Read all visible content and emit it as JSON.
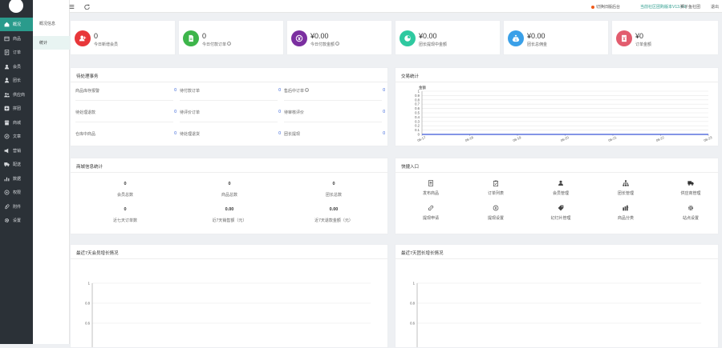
{
  "sidebar": {
    "items": [
      {
        "label": "概况",
        "icon": "home-icon",
        "active": true
      },
      {
        "label": "商品",
        "icon": "box-icon"
      },
      {
        "label": "订单",
        "icon": "order-icon"
      },
      {
        "label": "会员",
        "icon": "user-icon"
      },
      {
        "label": "团长",
        "icon": "leader-icon"
      },
      {
        "label": "供应商",
        "icon": "supplier-icon"
      },
      {
        "label": "拼团",
        "icon": "group-icon"
      },
      {
        "label": "商城",
        "icon": "shop-icon"
      },
      {
        "label": "文章",
        "icon": "article-icon"
      },
      {
        "label": "营销",
        "icon": "marketing-icon"
      },
      {
        "label": "配送",
        "icon": "truck-icon"
      },
      {
        "label": "数据",
        "icon": "data-icon"
      },
      {
        "label": "权限",
        "icon": "lock-icon"
      },
      {
        "label": "附件",
        "icon": "attachment-icon"
      },
      {
        "label": "设置",
        "icon": "gear-icon"
      }
    ]
  },
  "subnav": {
    "title": "概况信息",
    "items": [
      {
        "label": "统计",
        "active": true
      }
    ]
  },
  "topbar": {
    "switch_label": "切换旧版后台",
    "version_label": "当前社区团购版本V13.4.0",
    "store_label": "狮子鱼社团",
    "logout_label": "退出"
  },
  "stats": [
    {
      "value": "0",
      "label": "今日新增会员",
      "color": "#e8373a",
      "icon": "user-add-icon",
      "help": false
    },
    {
      "value": "0",
      "label": "今日付款订单",
      "color": "#3db54a",
      "icon": "document-icon",
      "help": true
    },
    {
      "value": "¥0.00",
      "label": "今日付款金额",
      "color": "#7b2fa0",
      "icon": "yen-icon",
      "help": true
    },
    {
      "value": "¥0.00",
      "label": "团长提现中金额",
      "color": "#2fc9a0",
      "icon": "pie-icon",
      "help": false
    },
    {
      "value": "¥0.00",
      "label": "团长总佣金",
      "color": "#3aa0e8",
      "icon": "money-bag-icon",
      "help": false
    },
    {
      "value": "¥0",
      "label": "订单金额",
      "color": "#e25c6e",
      "icon": "receipt-icon",
      "help": false
    }
  ],
  "todo": {
    "title": "待处理事务",
    "items": [
      {
        "label": "商品库存报警",
        "value": "0",
        "help": false
      },
      {
        "label": "待付款订单",
        "value": "0",
        "help": false
      },
      {
        "label": "售后中订单",
        "value": "0",
        "help": true
      },
      {
        "label": "待处理退款",
        "value": "0",
        "help": false
      },
      {
        "label": "待评价订单",
        "value": "0",
        "help": false
      },
      {
        "label": "待审核评价",
        "value": "0",
        "help": false
      },
      {
        "label": "仓库中商品",
        "value": "0",
        "help": false
      },
      {
        "label": "待处理退货",
        "value": "0",
        "help": false
      },
      {
        "label": "团长提现",
        "value": "0",
        "help": false
      }
    ]
  },
  "trade": {
    "title": "交易统计",
    "chart_data": {
      "type": "line",
      "ylabel": "金额",
      "ylim": [
        0,
        1
      ],
      "yticks": [
        "0",
        "0.1",
        "0.2",
        "0.3",
        "0.4",
        "0.5",
        "0.6",
        "0.7",
        "0.8",
        "0.9",
        "1"
      ],
      "categories": [
        "06-17",
        "06-18",
        "06-19",
        "06-20",
        "06-21",
        "06-22",
        "06-23"
      ],
      "series": [
        {
          "values": [
            0,
            0,
            0,
            0,
            0,
            0,
            0
          ],
          "color": "#3a56d6"
        }
      ]
    }
  },
  "mall": {
    "title": "商城信息统计",
    "items": [
      {
        "value": "0",
        "label": "会员总数"
      },
      {
        "value": "0",
        "label": "商品总数"
      },
      {
        "value": "0",
        "label": "团长总数"
      },
      {
        "value": "0",
        "label": "近七天订单数"
      },
      {
        "value": "0.00",
        "label": "近7天销售额（元）"
      },
      {
        "value": "0.00",
        "label": "近7天退款金额（元）"
      }
    ]
  },
  "quick": {
    "title": "快捷入口",
    "items": [
      {
        "label": "发布商品",
        "icon": "product-icon"
      },
      {
        "label": "订单列表",
        "icon": "clipboard-icon"
      },
      {
        "label": "会员管理",
        "icon": "members-icon"
      },
      {
        "label": "团长管理",
        "icon": "org-icon"
      },
      {
        "label": "供应商管理",
        "icon": "truck-icon"
      },
      {
        "label": "提现申请",
        "icon": "link-icon"
      },
      {
        "label": "提现设置",
        "icon": "coin-icon"
      },
      {
        "label": "幻灯片管理",
        "icon": "tag-icon"
      },
      {
        "label": "商品分类",
        "icon": "category-icon"
      },
      {
        "label": "站点设置",
        "icon": "gear-icon"
      }
    ]
  },
  "member_growth": {
    "title": "最近7天会员增长情况",
    "chart_data": {
      "type": "line",
      "yticks": [
        "1",
        "0.8",
        "0.6"
      ],
      "ylim": [
        0.6,
        1
      ]
    }
  },
  "leader_growth": {
    "title": "最近7天团长增长情况",
    "chart_data": {
      "type": "line",
      "yticks": [
        "1",
        "0.8",
        "0.6"
      ],
      "ylim": [
        0.6,
        1
      ]
    }
  }
}
